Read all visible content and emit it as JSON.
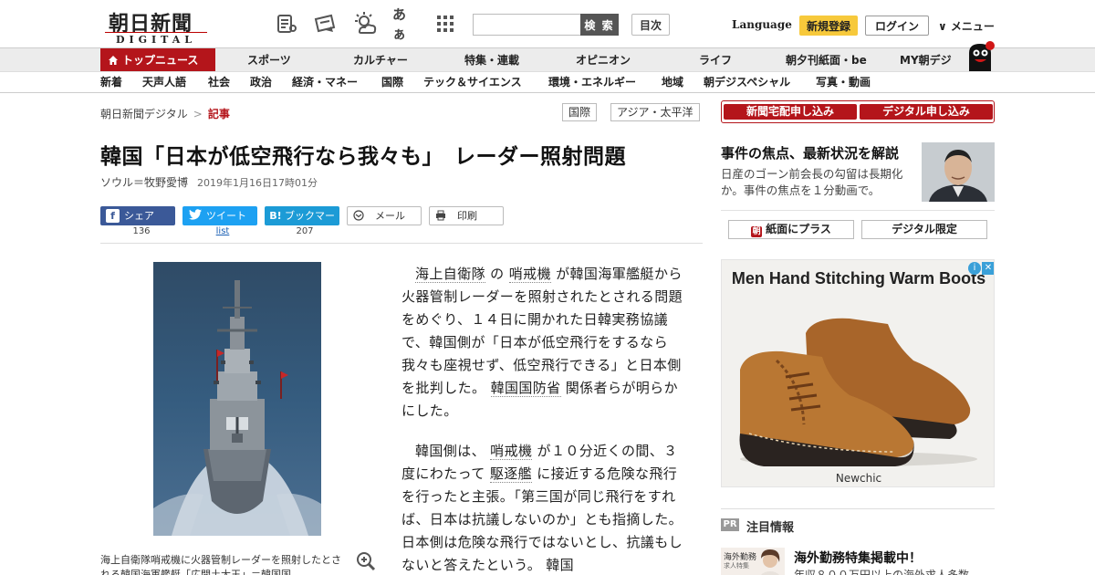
{
  "header": {
    "logo_main": "朝日新聞",
    "logo_sub": "DIGITAL",
    "kana_icon": "あぁ",
    "search_placeholder": "",
    "search_label": "検 索",
    "toc_label": "目次",
    "language_label": "Language",
    "register_label": "新規登録",
    "login_label": "ログイン",
    "menu_label": "∨ メニュー"
  },
  "nav_primary": [
    "トップニュース",
    "スポーツ",
    "カルチャー",
    "特集・連載",
    "オピニオン",
    "ライフ",
    "朝夕刊紙面・be",
    "MY朝デジ"
  ],
  "nav_secondary": [
    "新着",
    "天声人語",
    "社会",
    "政治",
    "経済・マネー",
    "国際",
    "テック＆サイエンス",
    "環境・エネルギー",
    "地域",
    "朝デジスペシャル",
    "写真・動画"
  ],
  "breadcrumb": {
    "home": "朝日新聞デジタル",
    "separator": ">",
    "current": "記事"
  },
  "tags": [
    "国際",
    "アジア・太平洋"
  ],
  "article": {
    "title": "韓国「日本が低空飛行なら我々も」　レーダー照射問題",
    "author": "ソウル＝牧野愛博",
    "date": "2019年1月16日17時01分",
    "share": {
      "facebook_label": "シェア",
      "facebook_count": "136",
      "twitter_label": "ツイート",
      "twitter_count": "list",
      "hatena_label": "ブックマーク",
      "hatena_icon": "B!",
      "hatena_count": "207",
      "mail_label": "メール",
      "print_label": "印刷"
    },
    "caption": "海上自衛隊哨戒機に火器管制レーダーを照射したとされる韓国海軍艦艇「広開土大王」＝韓国国",
    "paragraphs": [
      {
        "segments": [
          {
            "text": "海上自衛隊",
            "kw": true
          },
          {
            "text": " の ",
            "kw": false
          },
          {
            "text": "哨戒機",
            "kw": true
          },
          {
            "text": " が韓国海軍艦艇から火器管制レーダーを照射されたとされる問題をめぐり、１４日に開かれた日韓実務協議で、韓国側が「日本が低空飛行をするなら我々も座視せず、低空飛行できる」と日本側を批判した。 ",
            "kw": false
          },
          {
            "text": "韓国国防省",
            "kw": true
          },
          {
            "text": " 関係者らが明らかにした。",
            "kw": false
          }
        ]
      },
      {
        "segments": [
          {
            "text": "韓国側は、 ",
            "kw": false
          },
          {
            "text": "哨戒機",
            "kw": true
          },
          {
            "text": " が１０分近くの間、３度にわたって ",
            "kw": false
          },
          {
            "text": "駆逐艦",
            "kw": true
          },
          {
            "text": " に接近する危険な飛行を行ったと主張。「第三国が同じ飛行をすれば、日本は抗議しないのか」とも指摘した。日本側は危険な飛行ではないとし、抗議もしないと答えたという。 韓国",
            "kw": false
          }
        ]
      }
    ]
  },
  "sidebar": {
    "cta_home_delivery": "新聞宅配申し込み",
    "cta_digital": "デジタル申し込み",
    "focus_title": "事件の焦点、最新状況を解説",
    "focus_text": "日産のゴーン前会長の勾留は長期化か。事件の焦点を１分動画で。",
    "paper_plus": "紙面にプラス",
    "paper_plus_icon": "朝",
    "digital_only": "デジタル限定",
    "ad_title": "Men Hand Stitching Warm Boots",
    "ad_brand": "Newchic",
    "pr_tag": "PR",
    "pr_heading": "注目情報",
    "pr_thumb_text": "海外勤務",
    "pr_thumb_sub": "求人特集",
    "pr_title": "海外勤務特集掲載中！",
    "pr_sub": "年収８００万円以上の海外求人多数"
  },
  "colors": {
    "brand_red": "#b4151b",
    "register_yellow": "#f7c93b",
    "facebook": "#3b5998",
    "twitter": "#1da1f2",
    "hatena": "#1c9bd6"
  }
}
